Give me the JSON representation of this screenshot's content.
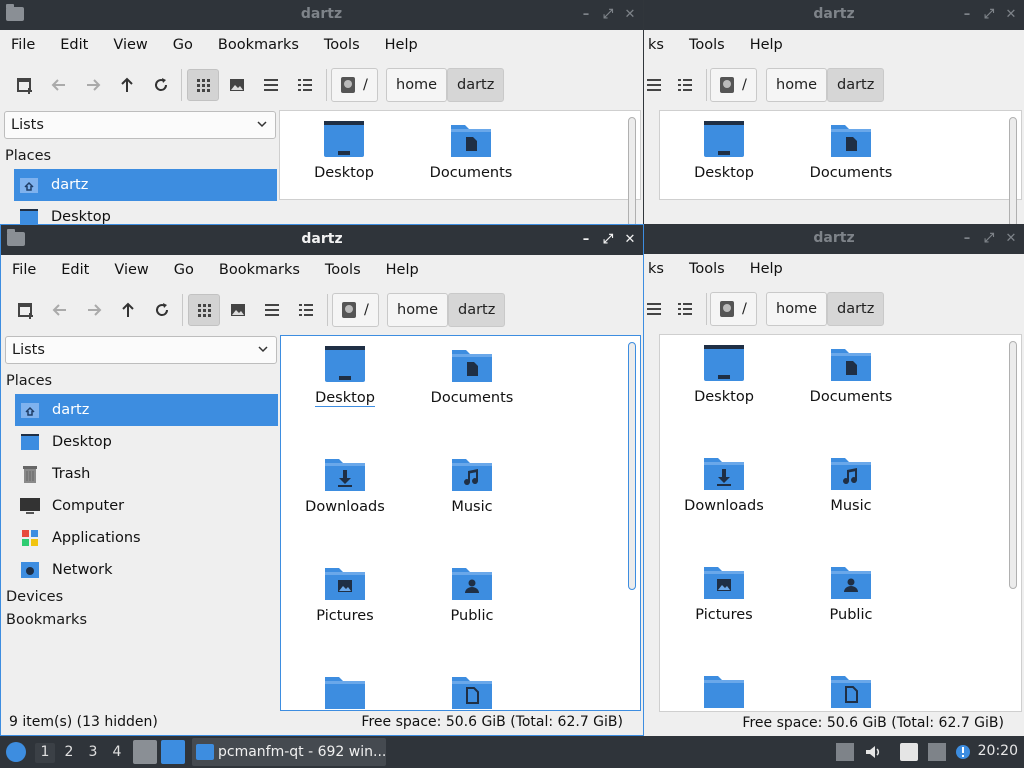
{
  "window_title": "dartz",
  "menu": [
    "File",
    "Edit",
    "View",
    "Go",
    "Bookmarks",
    "Tools",
    "Help"
  ],
  "menu_partial": [
    "Tools",
    "Help"
  ],
  "menu_cut": "ks",
  "path_crumbs": {
    "root": "/",
    "home": "home",
    "current": "dartz"
  },
  "sidebar": {
    "combo_value": "Lists",
    "places_heading": "Places",
    "places": [
      {
        "label": "dartz",
        "icon": "home-icon",
        "selected": true
      },
      {
        "label": "Desktop",
        "icon": "desktop-icon"
      },
      {
        "label": "Trash",
        "icon": "trash-icon"
      },
      {
        "label": "Computer",
        "icon": "computer-icon"
      },
      {
        "label": "Applications",
        "icon": "applications-icon"
      },
      {
        "label": "Network",
        "icon": "network-icon"
      }
    ],
    "devices_heading": "Devices",
    "bookmarks_heading": "Bookmarks"
  },
  "files": [
    {
      "label": "Desktop",
      "icon": "desktop-folder-icon"
    },
    {
      "label": "Documents",
      "icon": "documents-folder-icon"
    },
    {
      "label": "Downloads",
      "icon": "downloads-folder-icon"
    },
    {
      "label": "Music",
      "icon": "music-folder-icon"
    },
    {
      "label": "Pictures",
      "icon": "pictures-folder-icon"
    },
    {
      "label": "Public",
      "icon": "public-folder-icon"
    }
  ],
  "status": {
    "items": "9 item(s) (13 hidden)",
    "free_space": "Free space: 50.6 GiB (Total: 62.7 GiB)"
  },
  "taskbar": {
    "workspaces": [
      "1",
      "2",
      "3",
      "4"
    ],
    "task_label": "pcmanfm-qt - 692 win...",
    "clock": "20:20"
  },
  "colors": {
    "accent": "#3d8de0",
    "titlebar": "#2f343a",
    "folder": "#3d8de0"
  }
}
